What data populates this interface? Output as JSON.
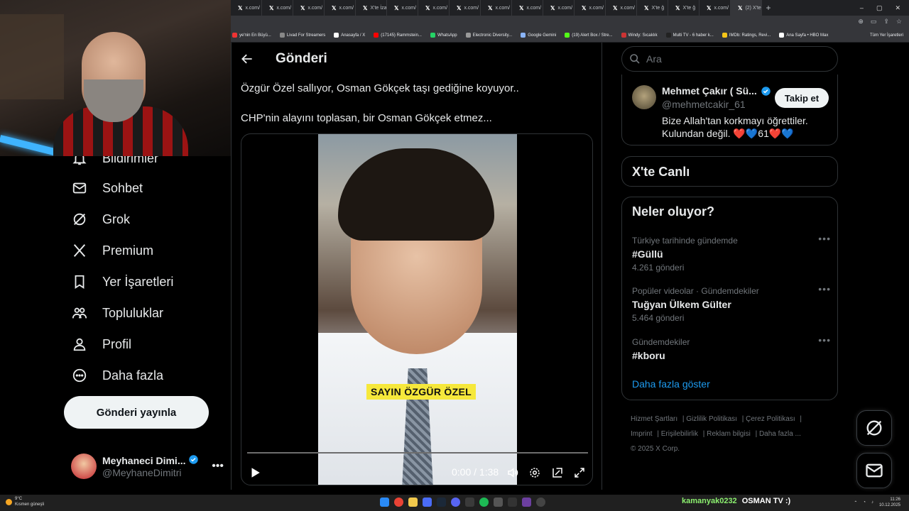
{
  "browser": {
    "tabs": [
      {
        "label": "x.com/"
      },
      {
        "label": "x.com/"
      },
      {
        "label": "x.com/"
      },
      {
        "label": "x.com/"
      },
      {
        "label": "X'te İza"
      },
      {
        "label": "x.com/"
      },
      {
        "label": "x.com/"
      },
      {
        "label": "x.com/"
      },
      {
        "label": "x.com/"
      },
      {
        "label": "x.com/"
      },
      {
        "label": "x.com/"
      },
      {
        "label": "x.com/"
      },
      {
        "label": "x.com/"
      },
      {
        "label": "X'te ğ"
      },
      {
        "label": "X'te ğ"
      },
      {
        "label": "x.com/"
      },
      {
        "label": "(2) X'te"
      }
    ],
    "new_tab": "+",
    "bookmarks": [
      {
        "label": "ye'nin En Büyü...",
        "color": "#e33"
      },
      {
        "label": "Livad For Streamers",
        "color": "#888"
      },
      {
        "label": "Anasayfa / X",
        "color": "#fff"
      },
      {
        "label": "(17145) Rammstein...",
        "color": "#f00"
      },
      {
        "label": "WhatsApp",
        "color": "#25d366"
      },
      {
        "label": "Electronic Diversity...",
        "color": "#999"
      },
      {
        "label": "Google Gemini",
        "color": "#8ab4f8"
      },
      {
        "label": "(19) Alert Box / Stre...",
        "color": "#53fc18"
      },
      {
        "label": "Windy: Sıcaklık",
        "color": "#c33"
      },
      {
        "label": "Multi TV - 6 haber k...",
        "color": "#222"
      },
      {
        "label": "IMDb: Ratings, Revi...",
        "color": "#f5c518"
      },
      {
        "label": "Ana Sayfa • HBO Max",
        "color": "#fff"
      }
    ],
    "all_bookmarks": "Tüm Yer İşaretleri"
  },
  "nav": {
    "items": [
      {
        "label": "Bildirimler",
        "icon": "bell-icon"
      },
      {
        "label": "Sohbet",
        "icon": "mail-icon"
      },
      {
        "label": "Grok",
        "icon": "grok-icon"
      },
      {
        "label": "Premium",
        "icon": "x-logo-icon"
      },
      {
        "label": "Yer İşaretleri",
        "icon": "bookmark-icon"
      },
      {
        "label": "Topluluklar",
        "icon": "communities-icon"
      },
      {
        "label": "Profil",
        "icon": "person-icon"
      },
      {
        "label": "Daha fazla",
        "icon": "more-circle-icon"
      }
    ],
    "post_button": "Gönderi yayınla",
    "account": {
      "display_name": "Meyhaneci Dimi...",
      "handle": "@MeyhaneDimitri"
    }
  },
  "main": {
    "title": "Gönderi",
    "post_text_1": "Özgür Özel sallıyor, Osman Gökçek taşı gediğine koyuyor..",
    "post_text_2": "CHP'nin alayını toplasan, bir Osman Gökçek etmez...",
    "video": {
      "caption": "SAYIN ÖZGÜR ÖZEL",
      "time": "0:00 / 1:38",
      "progress": 0
    }
  },
  "sidebar": {
    "search_placeholder": "Ara",
    "who_to_follow": {
      "name": "Mehmet Çakır ( Sü...",
      "handle": "@mehmetcakir_61",
      "bio_line1": "Bize Allah'tan korkmayı öğrettiler.",
      "bio_line2": "Kulundan değil. ❤️💙61❤️💙",
      "follow_label": "Takip et"
    },
    "live_title": "X'te Canlı",
    "trends_title": "Neler oluyor?",
    "trends": [
      {
        "context": "Türkiye tarihinde gündemde",
        "name": "#Güllü",
        "count": "4.261 gönderi"
      },
      {
        "context": "Popüler videolar · Gündemdekiler",
        "name": "Tuğyan Ülkem Gülter",
        "count": "5.464 gönderi"
      },
      {
        "context": "Gündemdekiler",
        "name": "#kboru",
        "count": ""
      }
    ],
    "show_more": "Daha fazla göster",
    "footer": {
      "links": [
        "Hizmet Şartları",
        "Gizlilik Politikası",
        "Çerez Politikası",
        "Imprint",
        "Erişilebilirlik",
        "Reklam bilgisi",
        "Daha fazla ..."
      ],
      "copyright": "© 2025 X Corp."
    }
  },
  "taskbar": {
    "weather_temp": "9°C",
    "weather_desc": "Kısmen güneşli",
    "stream_user": "kamanyak0232",
    "stream_msg": "OSMAN TV :)",
    "time": "11:26",
    "date": "10.12.2025"
  }
}
